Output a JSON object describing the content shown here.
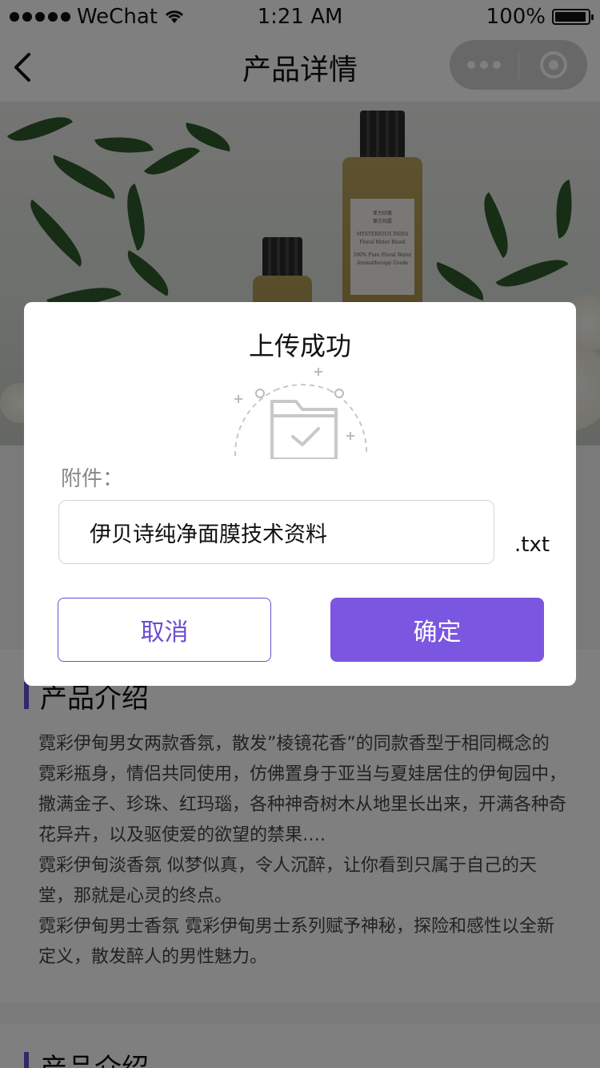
{
  "status_bar": {
    "carrier": "WeChat",
    "time": "1:21 AM",
    "battery": "100%"
  },
  "nav": {
    "title": "产品详情"
  },
  "hero": {
    "label_lines": [
      "亚力印度",
      "保方纯露",
      "MYSTERIOUS INDIA",
      "Floral Water Blend",
      "100% Pure Floral Water",
      "Aromatherapy Grade"
    ]
  },
  "sections": [
    {
      "title": "产品介绍",
      "paragraphs": [
        "霓彩伊甸男女两款香氛，散发”棱镜花香”的同款香型于相同概念的霓彩瓶身，情侣共同使用，仿佛置身于亚当与夏娃居住的伊甸园中，撒满金子、珍珠、红玛瑙，各种神奇树木从地里长出来，开满各种奇花异卉，以及驱使爱的欲望的禁果….",
        "霓彩伊甸淡香氛 似梦似真，令人沉醉，让你看到只属于自己的天堂，那就是心灵的终点。",
        "霓彩伊甸男士香氛 霓彩伊甸男士系列赋予神秘，探险和感性以全新定义，散发醉人的男性魅力。"
      ]
    },
    {
      "title": "产品介绍"
    }
  ],
  "dialog": {
    "title": "上传成功",
    "attachment_label": "附件：",
    "file_name": "伊贝诗纯净面膜技术资料",
    "file_ext": ".txt",
    "cancel_label": "取消",
    "confirm_label": "确定"
  }
}
